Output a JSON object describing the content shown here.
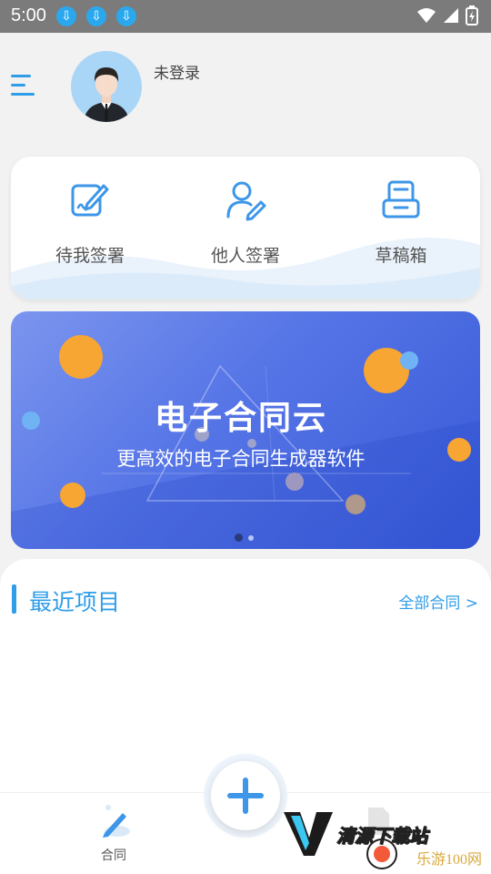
{
  "status_bar": {
    "time": "5:00",
    "download_icons": [
      "download-icon",
      "download-icon",
      "download-icon"
    ],
    "right_icons": [
      "wifi-icon",
      "signal-icon",
      "battery-charging-icon"
    ]
  },
  "header": {
    "login_status": "未登录"
  },
  "quick_actions": [
    {
      "label": "待我签署",
      "icon": "sign-pen-icon"
    },
    {
      "label": "他人签署",
      "icon": "person-edit-icon"
    },
    {
      "label": "草稿箱",
      "icon": "draft-box-icon"
    }
  ],
  "banner": {
    "title": "电子合同云",
    "subtitle": "更高效的电子合同生成器软件",
    "page_count": 2,
    "active_page": 1
  },
  "recent": {
    "title": "最近项目",
    "all_link": "全部合同",
    "chevron": ">"
  },
  "bottom_nav": {
    "contract_label": "合同",
    "fab_symbol": "+"
  },
  "watermark": {
    "text1": "清源下载站",
    "text2": "乐游100网"
  },
  "colors": {
    "accent": "#2f9de8",
    "banner_start": "#7b95ee",
    "banner_end": "#3658d6",
    "status_bar": "#7b7b7b"
  }
}
